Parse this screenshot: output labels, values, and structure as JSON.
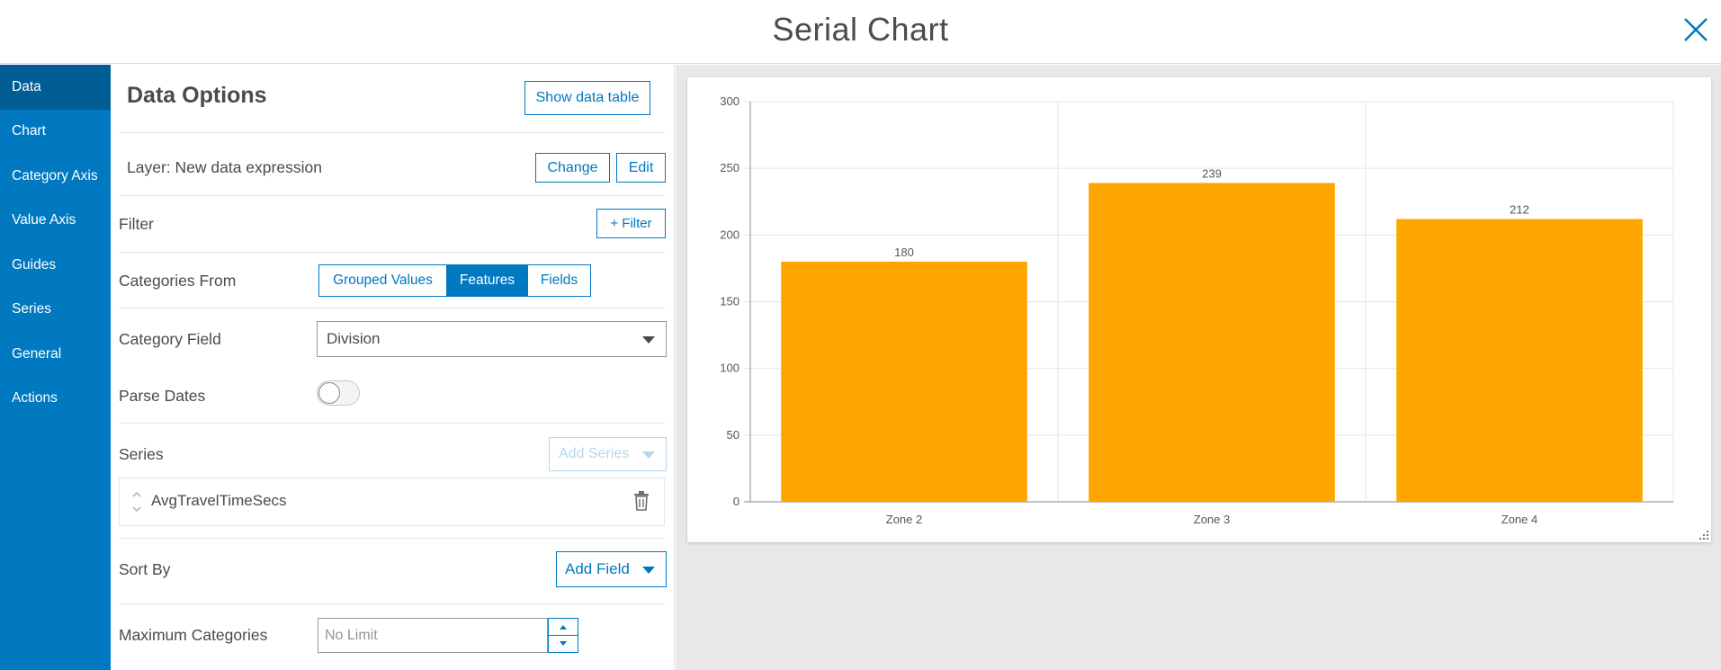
{
  "header": {
    "title": "Serial Chart"
  },
  "sidebar": {
    "items": [
      {
        "label": "Data"
      },
      {
        "label": "Chart"
      },
      {
        "label": "Category Axis"
      },
      {
        "label": "Value Axis"
      },
      {
        "label": "Guides"
      },
      {
        "label": "Series"
      },
      {
        "label": "General"
      },
      {
        "label": "Actions"
      }
    ]
  },
  "panel": {
    "title": "Data Options",
    "show_table_label": "Show data table",
    "layer_label": "Layer: New data expression",
    "change_label": "Change",
    "edit_label": "Edit",
    "filter_label": "Filter",
    "add_filter_label": "+ Filter",
    "categories_from_label": "Categories From",
    "seg_grouped": "Grouped Values",
    "seg_features": "Features",
    "seg_fields": "Fields",
    "category_field_label": "Category Field",
    "category_field_value": "Division",
    "parse_dates_label": "Parse Dates",
    "series_label": "Series",
    "add_series_label": "Add Series",
    "series_item": "AvgTravelTimeSecs",
    "sort_by_label": "Sort By",
    "add_field_label": "Add Field",
    "max_categories_label": "Maximum Categories",
    "max_categories_placeholder": "No Limit"
  },
  "chart_data": {
    "type": "bar",
    "categories": [
      "Zone 2",
      "Zone 3",
      "Zone 4"
    ],
    "values": [
      180,
      239,
      212
    ],
    "ylim": [
      0,
      300
    ],
    "yticks": [
      0,
      50,
      100,
      150,
      200,
      250,
      300
    ],
    "grid": true,
    "bar_color": "#ffa500",
    "data_labels": true
  }
}
